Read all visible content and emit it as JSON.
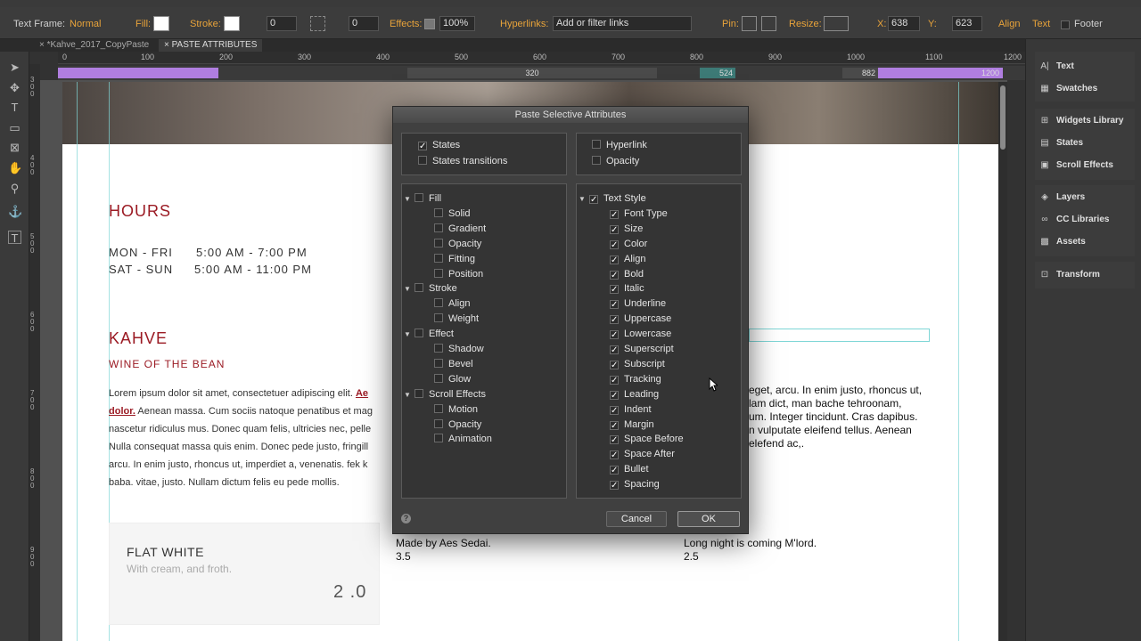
{
  "controlbar": {
    "text_frame_label": "Text Frame:",
    "text_frame_value": "Normal",
    "fill_label": "Fill:",
    "stroke_label": "Stroke:",
    "stroke_value": "0",
    "corner_value": "0",
    "effects_label": "Effects:",
    "effects_value": "100%",
    "hyperlinks_label": "Hyperlinks:",
    "hyperlinks_placeholder": "Add or filter links",
    "pin_label": "Pin:",
    "resize_label": "Resize:",
    "x_label": "X:",
    "x_value": "638",
    "y_label": "Y:",
    "y_value": "623",
    "align_label": "Align",
    "text_label": "Text",
    "footer_label": "Footer"
  },
  "tabs": [
    {
      "label": "*Kahve_2017_CopyPaste"
    },
    {
      "label": "PASTE ATTRIBUTES"
    }
  ],
  "ruler": {
    "h": [
      "0",
      "100",
      "200",
      "300",
      "400",
      "500",
      "600",
      "700",
      "800",
      "900",
      "1000",
      "1100",
      "1200"
    ],
    "v": [
      "300",
      "400",
      "500",
      "600",
      "700",
      "800",
      "900"
    ]
  },
  "breakpoints": {
    "mid": "320",
    "bp1": "524",
    "bp2": "882",
    "bp3": "1200"
  },
  "page": {
    "hours_title": "HOURS",
    "mon_fri": "MON - FRI",
    "mon_fri_time": "5:00 AM - 7:00 PM",
    "sat_sun": "SAT - SUN",
    "sat_sun_time": "5:00 AM - 11:00 PM",
    "kahve_title": "KAHVE",
    "subtitle": "WINE OF THE BEAN",
    "para_lines": [
      "Lorem ipsum dolor sit amet, consectetuer adipiscing elit.",
      "Aenean massa. Cum sociis natoque penatibus et mag",
      "nascetur ridiculus mus. Donec quam felis, ultricies nec, pelle",
      "Nulla consequat massa quis enim. Donec pede justo, fringill",
      "arcu. In enim justo, rhoncus ut, imperdiet a, venenatis. fek k",
      "baba. vitae, justo. Nullam dictum felis eu pede mollis."
    ],
    "link_1": "Ae",
    "link_2": "dolor.",
    "right_lines": [
      "eget, arcu. In enim justo, rhoncus ut,",
      "lam dict, man bache tehroonam,",
      "um. Integer tincidunt. Cras dapibus.",
      "n vulputate eleifend tellus. Aenean",
      "elefend ac,."
    ],
    "card_title": "FLAT WHITE",
    "card_sub": "With cream, and froth.",
    "card_price": "2 .0",
    "col2_text": "Made by Aes Sedai.",
    "col2_price": "3.5",
    "col3_text": "Long night is coming M'lord.",
    "col3_price": "2.5"
  },
  "right_panel": {
    "items": [
      {
        "label": "Text",
        "icon": "text-icon",
        "glyph": "A|"
      },
      {
        "label": "Swatches",
        "icon": "swatches-icon",
        "glyph": "▦"
      },
      {
        "label": "Widgets Library",
        "icon": "widgets-icon",
        "glyph": "⊞"
      },
      {
        "label": "States",
        "icon": "states-icon",
        "glyph": "▤"
      },
      {
        "label": "Scroll Effects",
        "icon": "scroll-effects-icon",
        "glyph": "▣"
      },
      {
        "label": "Layers",
        "icon": "layers-icon",
        "glyph": "◈"
      },
      {
        "label": "CC Libraries",
        "icon": "cc-libraries-icon",
        "glyph": "∞"
      },
      {
        "label": "Assets",
        "icon": "assets-icon",
        "glyph": "▩"
      },
      {
        "label": "Transform",
        "icon": "transform-icon",
        "glyph": "⊡"
      }
    ]
  },
  "dialog": {
    "title": "Paste Selective Attributes",
    "top_left": [
      {
        "label": "States",
        "checked": true
      },
      {
        "label": "States transitions",
        "checked": false
      }
    ],
    "top_right": [
      {
        "label": "Hyperlink",
        "checked": false
      },
      {
        "label": "Opacity",
        "checked": false
      }
    ],
    "left_tree": [
      {
        "label": "Fill",
        "level": 0,
        "checked": false
      },
      {
        "label": "Solid",
        "level": 1,
        "checked": false
      },
      {
        "label": "Gradient",
        "level": 1,
        "checked": false
      },
      {
        "label": "Opacity",
        "level": 1,
        "checked": false
      },
      {
        "label": "Fitting",
        "level": 1,
        "checked": false
      },
      {
        "label": "Position",
        "level": 1,
        "checked": false
      },
      {
        "label": "Stroke",
        "level": 0,
        "checked": false
      },
      {
        "label": "Align",
        "level": 1,
        "checked": false
      },
      {
        "label": "Weight",
        "level": 1,
        "checked": false
      },
      {
        "label": "Effect",
        "level": 0,
        "checked": false
      },
      {
        "label": "Shadow",
        "level": 1,
        "checked": false
      },
      {
        "label": "Bevel",
        "level": 1,
        "checked": false
      },
      {
        "label": "Glow",
        "level": 1,
        "checked": false
      },
      {
        "label": "Scroll Effects",
        "level": 0,
        "checked": false
      },
      {
        "label": "Motion",
        "level": 1,
        "checked": false
      },
      {
        "label": "Opacity",
        "level": 1,
        "checked": false
      },
      {
        "label": "Animation",
        "level": 1,
        "checked": false
      }
    ],
    "right_tree": [
      {
        "label": "Text Style",
        "level": 0,
        "checked": true
      },
      {
        "label": "Font Type",
        "level": 1,
        "checked": true
      },
      {
        "label": "Size",
        "level": 1,
        "checked": true
      },
      {
        "label": "Color",
        "level": 1,
        "checked": true
      },
      {
        "label": "Align",
        "level": 1,
        "checked": true
      },
      {
        "label": "Bold",
        "level": 1,
        "checked": true
      },
      {
        "label": "Italic",
        "level": 1,
        "checked": true
      },
      {
        "label": "Underline",
        "level": 1,
        "checked": true
      },
      {
        "label": "Uppercase",
        "level": 1,
        "checked": true
      },
      {
        "label": "Lowercase",
        "level": 1,
        "checked": true
      },
      {
        "label": "Superscript",
        "level": 1,
        "checked": true
      },
      {
        "label": "Subscript",
        "level": 1,
        "checked": true
      },
      {
        "label": "Tracking",
        "level": 1,
        "checked": true
      },
      {
        "label": "Leading",
        "level": 1,
        "checked": true
      },
      {
        "label": "Indent",
        "level": 1,
        "checked": true
      },
      {
        "label": "Margin",
        "level": 1,
        "checked": true
      },
      {
        "label": "Space Before",
        "level": 1,
        "checked": true
      },
      {
        "label": "Space After",
        "level": 1,
        "checked": true
      },
      {
        "label": "Bullet",
        "level": 1,
        "checked": true
      },
      {
        "label": "Spacing",
        "level": 1,
        "checked": true
      }
    ],
    "cancel_label": "Cancel",
    "ok_label": "OK",
    "help_glyph": "?"
  },
  "colors": {
    "accent_red": "#9b1b24",
    "control_orange": "#e8a33a",
    "breakpoint_purple": "#b07ee0"
  }
}
